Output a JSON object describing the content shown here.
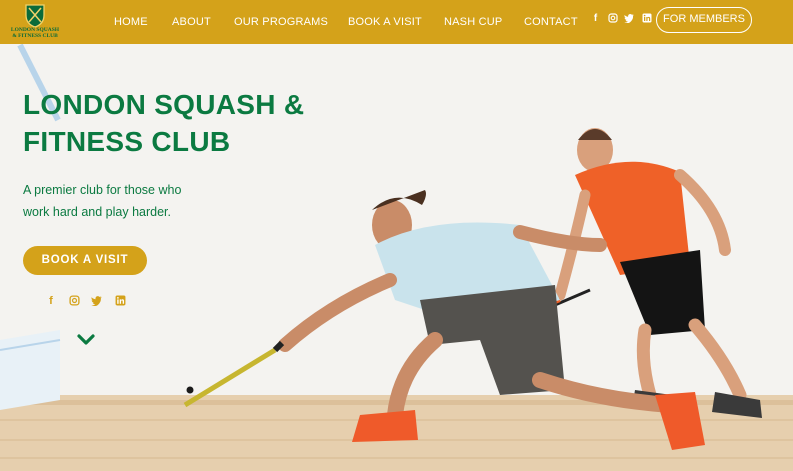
{
  "brand": {
    "logo_text": "LONDON SQUASH & FITNESS CLUB",
    "color_gold": "#d4a21a",
    "color_green": "#0b7a41"
  },
  "nav": {
    "items": [
      "HOME",
      "ABOUT",
      "OUR PROGRAMS",
      "BOOK A VISIT",
      "NASH CUP",
      "CONTACT"
    ],
    "members_label": "FOR MEMBERS",
    "social_icons": [
      "facebook-icon",
      "instagram-icon",
      "twitter-icon",
      "linkedin-icon"
    ]
  },
  "hero": {
    "title_line1": "LONDON SQUASH &",
    "title_line2": "FITNESS CLUB",
    "subtitle_line1": "A premier club for those who",
    "subtitle_line2": "work hard and play harder.",
    "cta_label": "BOOK A VISIT",
    "social_icons": [
      "facebook-icon",
      "instagram-icon",
      "twitter-icon",
      "linkedin-icon"
    ],
    "scroll_icon": "chevron-down-icon"
  }
}
